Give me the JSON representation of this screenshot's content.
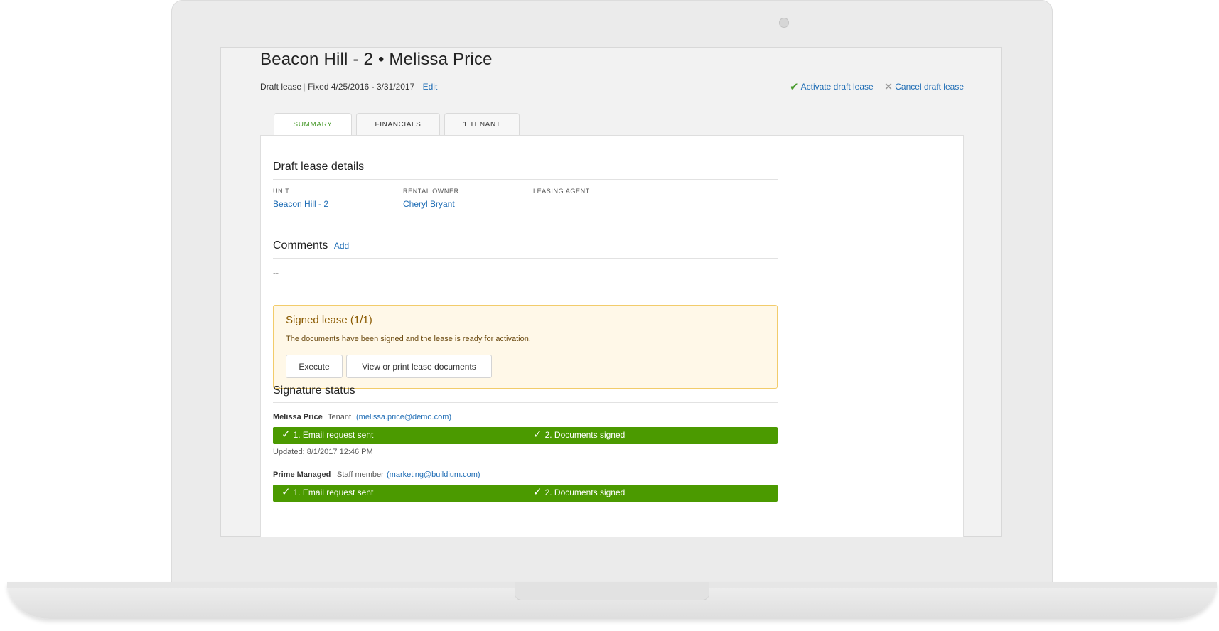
{
  "header": {
    "title": "Beacon Hill - 2 • Melissa Price",
    "lease_status": "Draft lease",
    "lease_term": "Fixed 4/25/2016 - 3/31/2017",
    "edit_label": "Edit",
    "activate_label": "Activate draft lease",
    "cancel_label": "Cancel draft lease"
  },
  "tabs": [
    {
      "label": "SUMMARY",
      "active": true
    },
    {
      "label": "FINANCIALS",
      "active": false
    },
    {
      "label": "1 TENANT",
      "active": false
    }
  ],
  "details": {
    "title": "Draft lease details",
    "unit_label": "UNIT",
    "unit_value": "Beacon Hill - 2",
    "owner_label": "RENTAL OWNER",
    "owner_value": "Cheryl Bryant",
    "agent_label": "LEASING AGENT"
  },
  "comments": {
    "title": "Comments",
    "add_label": "Add",
    "value": "--"
  },
  "signed_lease": {
    "title": "Signed lease (1/1)",
    "message": "The documents have been signed and the lease is ready for activation.",
    "execute_label": "Execute",
    "view_label": "View or print lease documents"
  },
  "signature_status": {
    "title": "Signature status",
    "signers": [
      {
        "name": "Melissa Price",
        "role": "Tenant",
        "email": "(melissa.price@demo.com)",
        "step1": "1. Email request sent",
        "step2": "2. Documents signed",
        "updated": "Updated: 8/1/2017 12:46 PM"
      },
      {
        "name": "Prime Managed",
        "role": "Staff member",
        "email": "(marketing@buildium.com)",
        "step1": "1. Email request sent",
        "step2": "2. Documents signed"
      }
    ]
  },
  "colors": {
    "accent_link": "#1f6db5",
    "success_green": "#4b9a00",
    "alert_border": "#f2cc6b",
    "alert_background": "#fff8e8"
  },
  "icons": {
    "activate": "check-icon",
    "cancel": "close-icon",
    "step": "check-icon"
  }
}
